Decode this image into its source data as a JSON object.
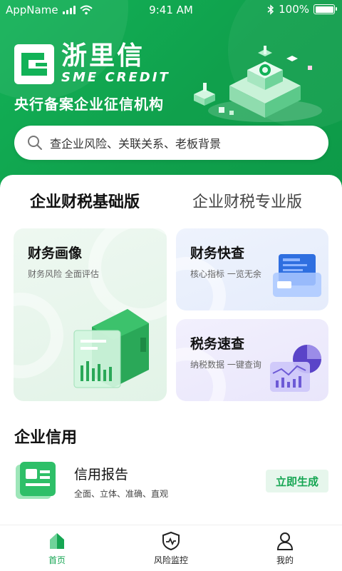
{
  "status_bar": {
    "carrier": "AppName",
    "time": "9:41 AM",
    "battery": "100%"
  },
  "header": {
    "logo_cn": "浙里信",
    "logo_en": "SME CREDIT",
    "slogan": "央行备案企业征信机构"
  },
  "search": {
    "placeholder": "查企业风险、关联关系、老板背景"
  },
  "tabs": [
    {
      "label": "企业财税基础版",
      "active": true
    },
    {
      "label": "企业财税专业版",
      "active": false
    }
  ],
  "cards": {
    "profile": {
      "title": "财务画像",
      "subtitle": "财务风险 全面评估"
    },
    "quick": {
      "title": "财务快查",
      "subtitle": "核心指标 一览无余"
    },
    "tax": {
      "title": "税务速查",
      "subtitle": "纳税数据 一键查询"
    }
  },
  "credit_section": {
    "title": "企业信用",
    "item_title": "信用报告",
    "item_subtitle": "全面、立体、准确、直观",
    "button": "立即生成"
  },
  "bottom_nav": [
    {
      "label": "首页",
      "icon": "home-icon",
      "active": true
    },
    {
      "label": "风险监控",
      "icon": "shield-pulse-icon",
      "active": false
    },
    {
      "label": "我的",
      "icon": "user-icon",
      "active": false
    }
  ],
  "colors": {
    "brand_green": "#16a653",
    "header_green": "#12b257"
  }
}
